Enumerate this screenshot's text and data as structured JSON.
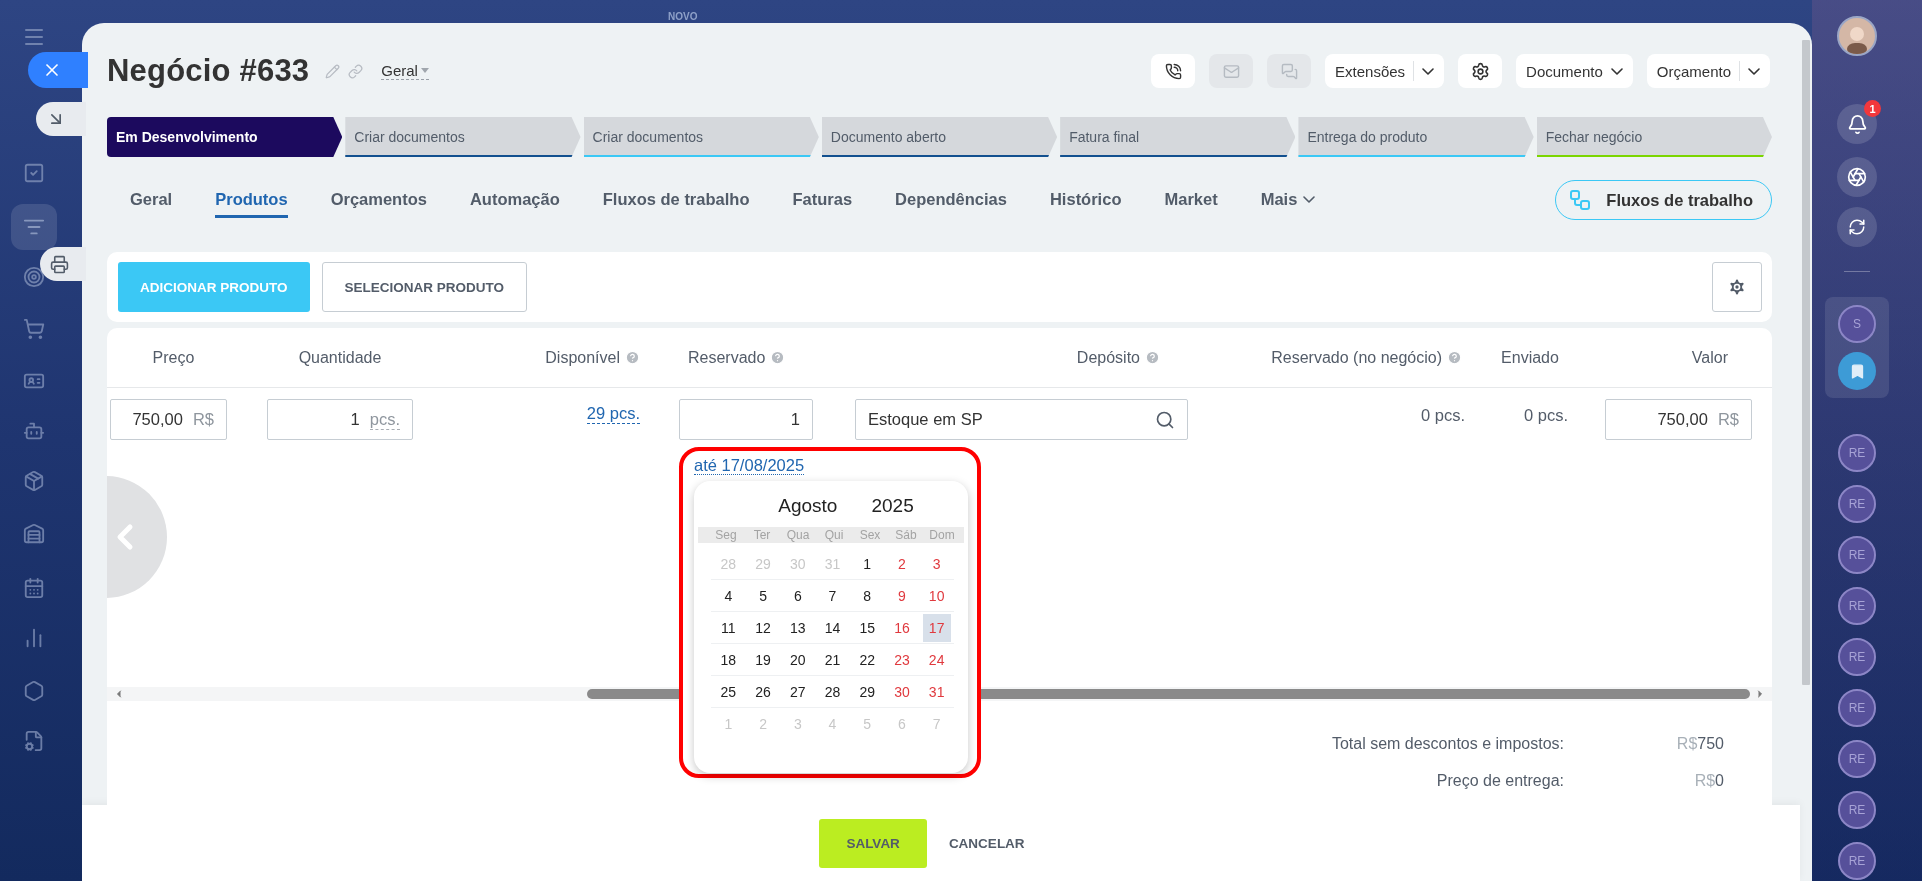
{
  "top_label": "NOVO",
  "deal": {
    "title": "Negócio #633",
    "category": "Geral"
  },
  "contact_buttons": [
    {
      "disabled": false
    },
    {
      "disabled": true
    },
    {
      "disabled": true
    }
  ],
  "menus": [
    {
      "kind": "split",
      "label": "Extensões"
    },
    {
      "kind": "settings"
    },
    {
      "kind": "dropdown",
      "label": "Documento"
    },
    {
      "kind": "split",
      "label": "Orçamento"
    }
  ],
  "stages": [
    {
      "label": "Em Desenvolvimento",
      "selected": true,
      "color": "#1c0a5e"
    },
    {
      "label": "Criar documentos",
      "selected": false,
      "color": "#12508f"
    },
    {
      "label": "Criar documentos",
      "selected": false,
      "color": "#3bc8f5"
    },
    {
      "label": "Documento aberto",
      "selected": false,
      "color": "#12508f"
    },
    {
      "label": "Fatura final",
      "selected": false,
      "color": "#12508f"
    },
    {
      "label": "Entrega do produto",
      "selected": false,
      "color": "#3bc8f5"
    },
    {
      "label": "Fechar negócio",
      "selected": false,
      "color": "#7bd500"
    }
  ],
  "tabs": [
    {
      "kind": "tab",
      "label": "Geral",
      "selected": false
    },
    {
      "kind": "tab",
      "label": "Produtos",
      "selected": true
    },
    {
      "kind": "tab",
      "label": "Orçamentos",
      "selected": false
    },
    {
      "kind": "tab",
      "label": "Automação",
      "selected": false
    },
    {
      "kind": "tab",
      "label": "Fluxos de trabalho",
      "selected": false
    },
    {
      "kind": "tab",
      "label": "Faturas",
      "selected": false
    },
    {
      "kind": "tab",
      "label": "Dependências",
      "selected": false
    },
    {
      "kind": "tab",
      "label": "Histórico",
      "selected": false
    },
    {
      "kind": "tab",
      "label": "Market",
      "selected": false
    },
    {
      "kind": "more",
      "label": "Mais",
      "selected": false
    }
  ],
  "workflow_button": {
    "label": "Fluxos de trabalho"
  },
  "product_actions": {
    "add": "ADICIONAR PRODUTO",
    "select": "SELECIONAR PRODUTO"
  },
  "table": {
    "columns": [
      {
        "label": "Preço",
        "help": false
      },
      {
        "label": "Quantidade",
        "help": false
      },
      {
        "label": "Disponível",
        "help": true
      },
      {
        "label": "Reservado",
        "help": true
      },
      {
        "label": "Depósito",
        "help": true
      },
      {
        "label": "Reservado (no negócio)",
        "help": true
      },
      {
        "label": "Enviado",
        "help": false
      },
      {
        "label": "Valor",
        "help": false
      }
    ],
    "row": {
      "price": {
        "value": "750,00",
        "currency": "R$"
      },
      "quantity": {
        "value": "1",
        "unit": "pcs."
      },
      "available": "29 pcs.",
      "reserved": "1",
      "reserve_until": "até 17/08/2025",
      "warehouse": "Estoque em SP",
      "reserved_in_deal": "0 pcs.",
      "shipped": "0 pcs.",
      "amount": {
        "value": "750,00",
        "currency": "R$"
      }
    }
  },
  "calendar": {
    "month": "Agosto",
    "year": "2025",
    "weekdays": [
      "Seg",
      "Ter",
      "Qua",
      "Qui",
      "Sex",
      "Sáb",
      "Dom"
    ],
    "weeks": [
      [
        {
          "day": "28",
          "kind": "outside",
          "selected": false
        },
        {
          "day": "29",
          "kind": "outside",
          "selected": false
        },
        {
          "day": "30",
          "kind": "outside",
          "selected": false
        },
        {
          "day": "31",
          "kind": "outside",
          "selected": false
        },
        {
          "day": "1",
          "kind": "weekday",
          "selected": false
        },
        {
          "day": "2",
          "kind": "weekend",
          "selected": false
        },
        {
          "day": "3",
          "kind": "weekend",
          "selected": false
        }
      ],
      [
        {
          "day": "4",
          "kind": "weekday",
          "selected": false
        },
        {
          "day": "5",
          "kind": "weekday",
          "selected": false
        },
        {
          "day": "6",
          "kind": "weekday",
          "selected": false
        },
        {
          "day": "7",
          "kind": "weekday",
          "selected": false
        },
        {
          "day": "8",
          "kind": "weekday",
          "selected": false
        },
        {
          "day": "9",
          "kind": "weekend",
          "selected": false
        },
        {
          "day": "10",
          "kind": "weekend",
          "selected": false
        }
      ],
      [
        {
          "day": "11",
          "kind": "weekday",
          "selected": false
        },
        {
          "day": "12",
          "kind": "weekday",
          "selected": false
        },
        {
          "day": "13",
          "kind": "weekday",
          "selected": false
        },
        {
          "day": "14",
          "kind": "weekday",
          "selected": false
        },
        {
          "day": "15",
          "kind": "weekday",
          "selected": false
        },
        {
          "day": "16",
          "kind": "weekend",
          "selected": false
        },
        {
          "day": "17",
          "kind": "weekend",
          "selected": true
        }
      ],
      [
        {
          "day": "18",
          "kind": "weekday",
          "selected": false
        },
        {
          "day": "19",
          "kind": "weekday",
          "selected": false
        },
        {
          "day": "20",
          "kind": "weekday",
          "selected": false
        },
        {
          "day": "21",
          "kind": "weekday",
          "selected": false
        },
        {
          "day": "22",
          "kind": "weekday",
          "selected": false
        },
        {
          "day": "23",
          "kind": "weekend",
          "selected": false
        },
        {
          "day": "24",
          "kind": "weekend",
          "selected": false
        }
      ],
      [
        {
          "day": "25",
          "kind": "weekday",
          "selected": false
        },
        {
          "day": "26",
          "kind": "weekday",
          "selected": false
        },
        {
          "day": "27",
          "kind": "weekday",
          "selected": false
        },
        {
          "day": "28",
          "kind": "weekday",
          "selected": false
        },
        {
          "day": "29",
          "kind": "weekday",
          "selected": false
        },
        {
          "day": "30",
          "kind": "weekend",
          "selected": false
        },
        {
          "day": "31",
          "kind": "weekend",
          "selected": false
        }
      ],
      [
        {
          "day": "1",
          "kind": "outside",
          "selected": false
        },
        {
          "day": "2",
          "kind": "outside",
          "selected": false
        },
        {
          "day": "3",
          "kind": "outside",
          "selected": false
        },
        {
          "day": "4",
          "kind": "outside",
          "selected": false
        },
        {
          "day": "5",
          "kind": "outside",
          "selected": false
        },
        {
          "day": "6",
          "kind": "outside",
          "selected": false
        },
        {
          "day": "7",
          "kind": "outside",
          "selected": false
        }
      ]
    ]
  },
  "totals": [
    {
      "label": "Total sem descontos e impostos:",
      "currency": "R$",
      "value": "750"
    },
    {
      "label": "Preço de entrega:",
      "currency": "R$",
      "value": "0"
    }
  ],
  "footer": {
    "save": "SALVAR",
    "cancel": "CANCELAR"
  },
  "notifications": {
    "badge": "1"
  },
  "pinned_chats": [
    {
      "initials": "S"
    }
  ],
  "recent_chats": [
    {
      "initials": "RE"
    },
    {
      "initials": "RE"
    },
    {
      "initials": "RE"
    },
    {
      "initials": "RE"
    },
    {
      "initials": "RE"
    },
    {
      "initials": "RE"
    },
    {
      "initials": "RE"
    },
    {
      "initials": "RE"
    },
    {
      "initials": "RE"
    }
  ]
}
